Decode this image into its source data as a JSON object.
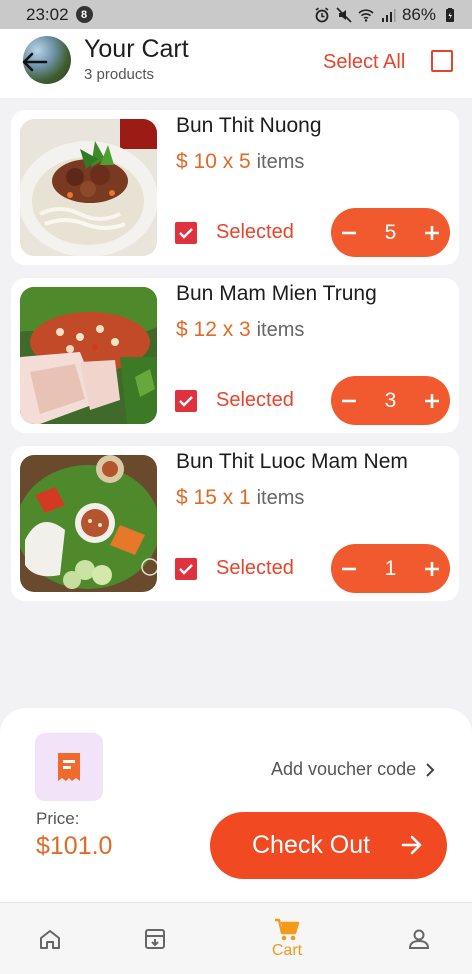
{
  "status_bar": {
    "time": "23:02",
    "notification_count": "8",
    "battery": "86%"
  },
  "header": {
    "title": "Your Cart",
    "subtitle": "3 products",
    "select_all_label": "Select All",
    "select_all_checked": false
  },
  "cart": {
    "items": [
      {
        "name": "Bun Thit Nuong",
        "price_text": "$ 10 x 5",
        "unit": "items",
        "selected_label": "Selected",
        "quantity": "5",
        "selected": true
      },
      {
        "name": "Bun Mam Mien Trung",
        "price_text": "$ 12 x 3",
        "unit": "items",
        "selected_label": "Selected",
        "quantity": "3",
        "selected": true
      },
      {
        "name": "Bun Thit Luoc Mam Nem",
        "price_text": "$ 15 x 1",
        "unit": "items",
        "selected_label": "Selected",
        "quantity": "1",
        "selected": true
      }
    ]
  },
  "summary": {
    "voucher_label": "Add voucher code",
    "price_label": "Price:",
    "price_value": "$101.0",
    "checkout_label": "Check Out"
  },
  "nav": {
    "items": [
      {
        "icon": "home-icon",
        "label": ""
      },
      {
        "icon": "archive-icon",
        "label": ""
      },
      {
        "icon": "cart-icon",
        "label": "Cart",
        "active": true
      },
      {
        "icon": "profile-icon",
        "label": ""
      }
    ]
  },
  "colors": {
    "accent": "#f14a22",
    "price": "#e06a27",
    "checkbox": "#e0313f",
    "nav_active": "#f39a1b",
    "voucher_bg": "#f2e3f9"
  }
}
